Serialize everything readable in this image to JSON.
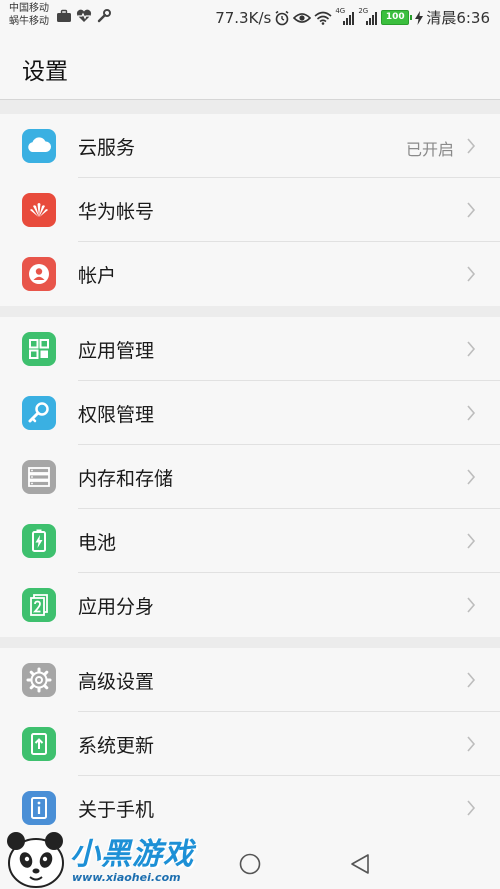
{
  "status_bar": {
    "carrier_1": "中国移动",
    "carrier_2": "蜗牛移动",
    "speed": "77.3K/s",
    "signal_1": "4G",
    "signal_2": "2G",
    "battery": "100",
    "time": "清晨6:36"
  },
  "header": {
    "title": "设置"
  },
  "groups": [
    {
      "items": [
        {
          "label": "云服务",
          "value": "已开启",
          "icon": "cloud-icon",
          "color": "#3ab0e2"
        },
        {
          "label": "华为帐号",
          "icon": "huawei-icon",
          "color": "#e84b3c"
        },
        {
          "label": "帐户",
          "icon": "account-icon",
          "color": "#e8554a"
        }
      ]
    },
    {
      "items": [
        {
          "label": "应用管理",
          "icon": "apps-grid-icon",
          "color": "#3ec06e"
        },
        {
          "label": "权限管理",
          "icon": "key-icon",
          "color": "#3ab0e2"
        },
        {
          "label": "内存和存储",
          "icon": "storage-icon",
          "color": "#a6a6a6"
        },
        {
          "label": "电池",
          "icon": "battery-icon",
          "color": "#3ec06e"
        },
        {
          "label": "应用分身",
          "icon": "app-twin-icon",
          "color": "#3ec06e"
        }
      ]
    },
    {
      "items": [
        {
          "label": "高级设置",
          "icon": "gear-icon",
          "color": "#a6a6a6"
        },
        {
          "label": "系统更新",
          "icon": "system-update-icon",
          "color": "#3ec06e"
        },
        {
          "label": "关于手机",
          "icon": "info-icon",
          "color": "#4a8fd6"
        }
      ]
    }
  ],
  "watermark": {
    "title": "小黑游戏",
    "url": "www.xiaohei.com"
  }
}
